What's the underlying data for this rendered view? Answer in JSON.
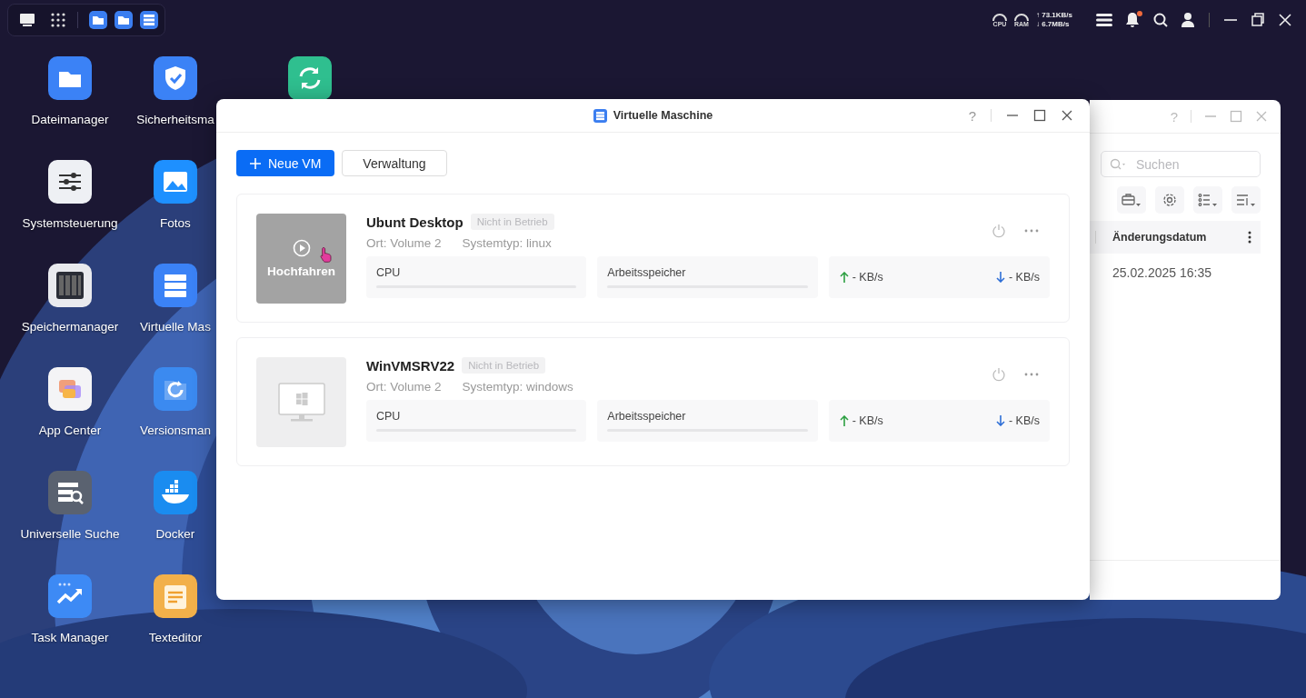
{
  "system_monitor": {
    "cpu_label": "CPU",
    "ram_label": "RAM",
    "upload": "↑ 73.1KB/s",
    "download": "↓ 6.7MB/s"
  },
  "notifications": {
    "unread": true
  },
  "desktop_icons": [
    {
      "label": "Dateimanager"
    },
    {
      "label": "Sicherheitsma"
    },
    {
      "label": "Systemsteuerung"
    },
    {
      "label": "Fotos"
    },
    {
      "label": "Speichermanager"
    },
    {
      "label": "Virtuelle Mas"
    },
    {
      "label": "App Center"
    },
    {
      "label": "Versionsman"
    },
    {
      "label": "Universelle Suche"
    },
    {
      "label": "Docker"
    },
    {
      "label": "Task Manager"
    },
    {
      "label": "Texteditor"
    }
  ],
  "back_window": {
    "help": "?",
    "search": {
      "placeholder": "Suchen"
    },
    "columns": [
      "Änderungsdatum"
    ],
    "rows": [
      [
        "25.02.2025 16:35"
      ]
    ]
  },
  "window": {
    "title": "Virtuelle Maschine",
    "help": "?",
    "toolbar": [
      {
        "label": "Neue VM",
        "kind": "primary"
      },
      {
        "label": "Verwaltung",
        "kind": "secondary"
      }
    ],
    "vms": [
      {
        "name": "Ubunt Desktop",
        "status": "Nicht in Betrieb",
        "running": false,
        "location": "Ort: Volume 2",
        "system_type": "Systemtyp: linux",
        "overlay_label": "Hochfahren",
        "cpu": {
          "label": "CPU",
          "level": 0
        },
        "memory": {
          "label": "Arbeitsspeicher",
          "level": 0
        },
        "upload": "- KB/s",
        "download": "- KB/s"
      },
      {
        "name": "WinVMSRV22",
        "status": "Nicht in Betrieb",
        "running": false,
        "location": "Ort: Volume 2",
        "system_type": "Systemtyp: windows",
        "cpu": {
          "label": "CPU",
          "level": 0
        },
        "memory": {
          "label": "Arbeitsspeicher",
          "level": 0
        },
        "upload": "- KB/s",
        "download": "- KB/s"
      }
    ]
  }
}
